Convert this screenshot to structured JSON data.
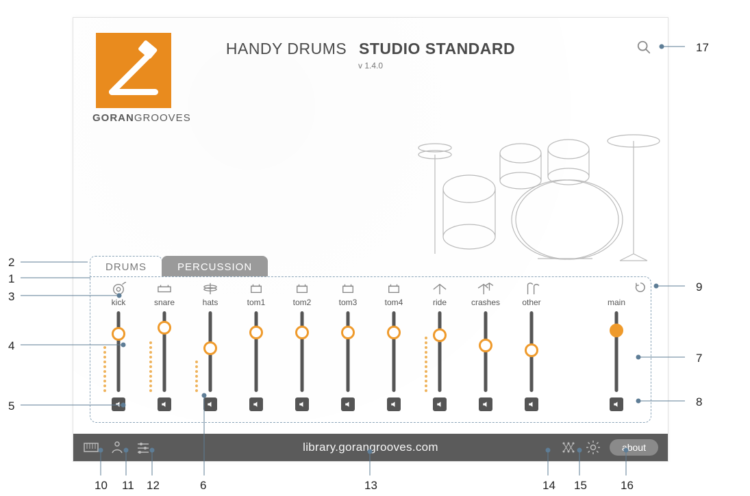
{
  "logo": {
    "brand_a": "GORAN",
    "brand_b": "GROOVES"
  },
  "header": {
    "title_a": "HANDY DRUMS",
    "title_b": "STUDIO STANDARD",
    "version": "v 1.4.0"
  },
  "tabs": {
    "drums": "DRUMS",
    "percussion": "PERCUSSION"
  },
  "mixer": {
    "channels": [
      {
        "name": "kick",
        "label": "kick",
        "icon": "kick",
        "level": 0.28,
        "meter": 10
      },
      {
        "name": "snare",
        "label": "snare",
        "icon": "snare",
        "level": 0.2,
        "meter": 11
      },
      {
        "name": "hats",
        "label": "hats",
        "icon": "hats",
        "level": 0.46,
        "meter": 7
      },
      {
        "name": "tom1",
        "label": "tom1",
        "icon": "tom",
        "level": 0.26,
        "meter": 0
      },
      {
        "name": "tom2",
        "label": "tom2",
        "icon": "tom",
        "level": 0.26,
        "meter": 0
      },
      {
        "name": "tom3",
        "label": "tom3",
        "icon": "tom",
        "level": 0.26,
        "meter": 0
      },
      {
        "name": "tom4",
        "label": "tom4",
        "icon": "tom",
        "level": 0.26,
        "meter": 0
      },
      {
        "name": "ride",
        "label": "ride",
        "icon": "ride",
        "level": 0.3,
        "meter": 12
      },
      {
        "name": "crashes",
        "label": "crashes",
        "icon": "crash",
        "level": 0.42,
        "meter": 0
      },
      {
        "name": "other",
        "label": "other",
        "icon": "other",
        "level": 0.48,
        "meter": 0
      }
    ],
    "main": {
      "label": "main",
      "level": 0.24,
      "meter": 0
    }
  },
  "footer": {
    "link": "library.gorangrooves.com",
    "about": "about"
  },
  "callouts": {
    "1": "1",
    "2": "2",
    "3": "3",
    "4": "4",
    "5": "5",
    "6": "6",
    "7": "7",
    "8": "8",
    "9": "9",
    "10": "10",
    "11": "11",
    "12": "12",
    "13": "13",
    "14": "14",
    "15": "15",
    "16": "16",
    "17": "17"
  },
  "colors": {
    "accent": "#ef9a2b",
    "footer": "#5b5b5b",
    "dash": "#8aa4b8"
  }
}
